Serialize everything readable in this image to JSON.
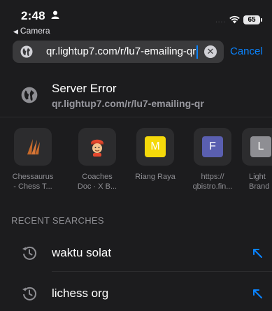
{
  "status_bar": {
    "time": "2:48",
    "back_app": "Camera",
    "signal": "....",
    "battery": "65"
  },
  "search": {
    "value": "qr.lightup7.com/r/lu7-emailing-qr",
    "cancel_label": "Cancel",
    "clear_symbol": "✕"
  },
  "suggestion": {
    "title": "Server Error",
    "url": "qr.lightup7.com/r/lu7-emailing-qr"
  },
  "favorites": [
    {
      "label_line1": "Chessaurus",
      "label_line2": "- Chess T...",
      "icon": "chessaurus-claw-icon"
    },
    {
      "label_line1": "Coaches",
      "label_line2": "Doc · X B...",
      "icon": "coach-avatar-icon"
    },
    {
      "label_line1": "Riang Raya",
      "label_line2": "",
      "tile_letter": "M",
      "icon": "letter-tile-icon"
    },
    {
      "label_line1": "https://",
      "label_line2": "qbistro.fin...",
      "tile_letter": "F",
      "icon": "letter-tile-icon"
    },
    {
      "label_line1": "Light",
      "label_line2": "Brand",
      "tile_letter": "L",
      "icon": "letter-tile-icon"
    }
  ],
  "recent_searches": {
    "header": "RECENT SEARCHES",
    "items": [
      {
        "label": "waktu solat"
      },
      {
        "label": "lichess org"
      }
    ]
  },
  "colors": {
    "background": "#1c1c1e",
    "search_field": "#3a3a3c",
    "accent": "#0a84ff",
    "tile": "#2c2c2e",
    "riang_raya_yellow": "#f5d90a",
    "qbistro_purple": "#5a5fb0",
    "chessaurus_orange": "#c86a2a"
  }
}
